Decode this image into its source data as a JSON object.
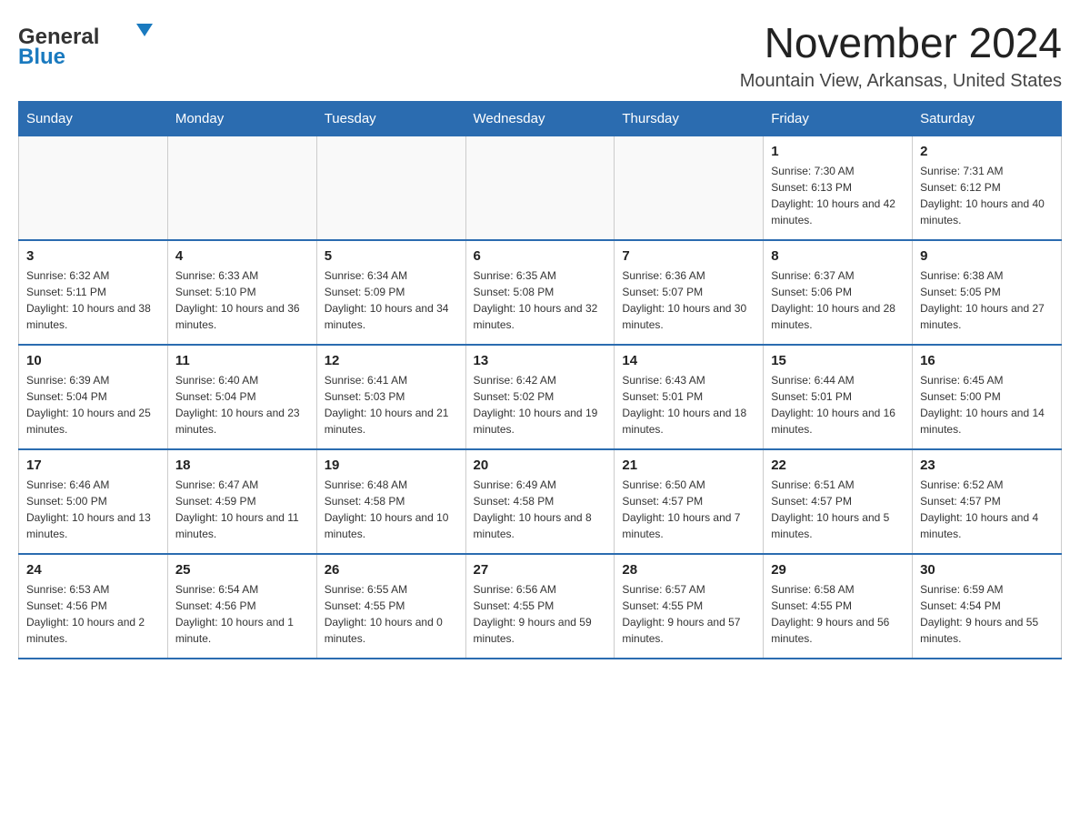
{
  "logo": {
    "general": "General",
    "blue": "Blue"
  },
  "title": "November 2024",
  "location": "Mountain View, Arkansas, United States",
  "weekdays": [
    "Sunday",
    "Monday",
    "Tuesday",
    "Wednesday",
    "Thursday",
    "Friday",
    "Saturday"
  ],
  "weeks": [
    [
      {
        "day": "",
        "info": ""
      },
      {
        "day": "",
        "info": ""
      },
      {
        "day": "",
        "info": ""
      },
      {
        "day": "",
        "info": ""
      },
      {
        "day": "",
        "info": ""
      },
      {
        "day": "1",
        "info": "Sunrise: 7:30 AM\nSunset: 6:13 PM\nDaylight: 10 hours and 42 minutes."
      },
      {
        "day": "2",
        "info": "Sunrise: 7:31 AM\nSunset: 6:12 PM\nDaylight: 10 hours and 40 minutes."
      }
    ],
    [
      {
        "day": "3",
        "info": "Sunrise: 6:32 AM\nSunset: 5:11 PM\nDaylight: 10 hours and 38 minutes."
      },
      {
        "day": "4",
        "info": "Sunrise: 6:33 AM\nSunset: 5:10 PM\nDaylight: 10 hours and 36 minutes."
      },
      {
        "day": "5",
        "info": "Sunrise: 6:34 AM\nSunset: 5:09 PM\nDaylight: 10 hours and 34 minutes."
      },
      {
        "day": "6",
        "info": "Sunrise: 6:35 AM\nSunset: 5:08 PM\nDaylight: 10 hours and 32 minutes."
      },
      {
        "day": "7",
        "info": "Sunrise: 6:36 AM\nSunset: 5:07 PM\nDaylight: 10 hours and 30 minutes."
      },
      {
        "day": "8",
        "info": "Sunrise: 6:37 AM\nSunset: 5:06 PM\nDaylight: 10 hours and 28 minutes."
      },
      {
        "day": "9",
        "info": "Sunrise: 6:38 AM\nSunset: 5:05 PM\nDaylight: 10 hours and 27 minutes."
      }
    ],
    [
      {
        "day": "10",
        "info": "Sunrise: 6:39 AM\nSunset: 5:04 PM\nDaylight: 10 hours and 25 minutes."
      },
      {
        "day": "11",
        "info": "Sunrise: 6:40 AM\nSunset: 5:04 PM\nDaylight: 10 hours and 23 minutes."
      },
      {
        "day": "12",
        "info": "Sunrise: 6:41 AM\nSunset: 5:03 PM\nDaylight: 10 hours and 21 minutes."
      },
      {
        "day": "13",
        "info": "Sunrise: 6:42 AM\nSunset: 5:02 PM\nDaylight: 10 hours and 19 minutes."
      },
      {
        "day": "14",
        "info": "Sunrise: 6:43 AM\nSunset: 5:01 PM\nDaylight: 10 hours and 18 minutes."
      },
      {
        "day": "15",
        "info": "Sunrise: 6:44 AM\nSunset: 5:01 PM\nDaylight: 10 hours and 16 minutes."
      },
      {
        "day": "16",
        "info": "Sunrise: 6:45 AM\nSunset: 5:00 PM\nDaylight: 10 hours and 14 minutes."
      }
    ],
    [
      {
        "day": "17",
        "info": "Sunrise: 6:46 AM\nSunset: 5:00 PM\nDaylight: 10 hours and 13 minutes."
      },
      {
        "day": "18",
        "info": "Sunrise: 6:47 AM\nSunset: 4:59 PM\nDaylight: 10 hours and 11 minutes."
      },
      {
        "day": "19",
        "info": "Sunrise: 6:48 AM\nSunset: 4:58 PM\nDaylight: 10 hours and 10 minutes."
      },
      {
        "day": "20",
        "info": "Sunrise: 6:49 AM\nSunset: 4:58 PM\nDaylight: 10 hours and 8 minutes."
      },
      {
        "day": "21",
        "info": "Sunrise: 6:50 AM\nSunset: 4:57 PM\nDaylight: 10 hours and 7 minutes."
      },
      {
        "day": "22",
        "info": "Sunrise: 6:51 AM\nSunset: 4:57 PM\nDaylight: 10 hours and 5 minutes."
      },
      {
        "day": "23",
        "info": "Sunrise: 6:52 AM\nSunset: 4:57 PM\nDaylight: 10 hours and 4 minutes."
      }
    ],
    [
      {
        "day": "24",
        "info": "Sunrise: 6:53 AM\nSunset: 4:56 PM\nDaylight: 10 hours and 2 minutes."
      },
      {
        "day": "25",
        "info": "Sunrise: 6:54 AM\nSunset: 4:56 PM\nDaylight: 10 hours and 1 minute."
      },
      {
        "day": "26",
        "info": "Sunrise: 6:55 AM\nSunset: 4:55 PM\nDaylight: 10 hours and 0 minutes."
      },
      {
        "day": "27",
        "info": "Sunrise: 6:56 AM\nSunset: 4:55 PM\nDaylight: 9 hours and 59 minutes."
      },
      {
        "day": "28",
        "info": "Sunrise: 6:57 AM\nSunset: 4:55 PM\nDaylight: 9 hours and 57 minutes."
      },
      {
        "day": "29",
        "info": "Sunrise: 6:58 AM\nSunset: 4:55 PM\nDaylight: 9 hours and 56 minutes."
      },
      {
        "day": "30",
        "info": "Sunrise: 6:59 AM\nSunset: 4:54 PM\nDaylight: 9 hours and 55 minutes."
      }
    ]
  ]
}
